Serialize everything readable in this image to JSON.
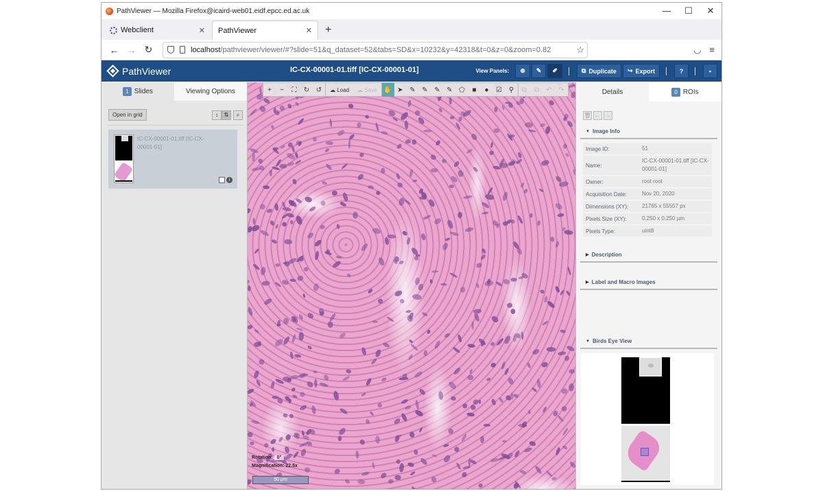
{
  "window": {
    "title": "PathViewer — Mozilla Firefox@icaird-web01.eidf.epcc.ed.ac.uk",
    "controls": [
      "—",
      "☐",
      "✕"
    ]
  },
  "tabs": [
    {
      "label": "Webclient",
      "close": "✕"
    },
    {
      "label": "PathViewer",
      "close": "✕"
    }
  ],
  "newtab": "+",
  "nav": {
    "back": "←",
    "forward": "→",
    "reload": "↻",
    "url_host": "localhost",
    "url_rest": "/pathviewer/viewer/#?slide=51&q_dataset=52&tabs=SD&x=10232&y=42318&t=0&z=0&zoom=0.82",
    "star": "☆",
    "pocket": "◡",
    "menu": "≡"
  },
  "app": {
    "logo_text": "PathViewer",
    "title": "IC-CX-00001-01.tiff [IC-CX-00001-01]",
    "view_panels_label": "View Panels:",
    "duplicate_label": "Duplicate",
    "export_label": "Export",
    "help_label": "?",
    "icons": {
      "globe": "⊕",
      "wrench": "✎",
      "pen": "✐",
      "duplicate": "⧉",
      "export": "↪",
      "window": "▪"
    }
  },
  "left_panel": {
    "slides_count": "1",
    "slides_tab": "Slides",
    "viewing_options_tab": "Viewing Options",
    "open_in_grid": "Open in grid",
    "sort_asc": "↕",
    "sort_desc": "⇅",
    "search_icon": "⌕",
    "thumbnail": {
      "name": "IC-CX-00001-01.tiff [IC-CX-00001-01]",
      "info": "i"
    }
  },
  "viewer": {
    "tools": {
      "zoom_in": "+",
      "zoom_out": "−",
      "fit": "⛶",
      "rotate_cw": "↻",
      "rotate_ccw": "↺",
      "load": "Load",
      "save": "Save",
      "pan": "✋",
      "select": "➤",
      "pen1": "✎",
      "pen2": "✎",
      "pen3": "✎",
      "pen4": "✎",
      "polygon": "⬠",
      "rect": "■",
      "circle": "●",
      "check": "☑",
      "marker": "⚲",
      "copy": "⧉",
      "paste": "⧉",
      "undo": "↶",
      "redo": "↷"
    },
    "rotation_label": "Rotation:",
    "rotation_value": "0°",
    "magnification_label": "Magnification:",
    "magnification_value": "22.5x",
    "scale_label": "50 µm"
  },
  "right_panel": {
    "details_tab": "Details",
    "rois_count": "0",
    "rois_tab": "ROIs",
    "btn_delete": "🗑",
    "btn_prev": "←",
    "btn_next": "→",
    "image_info_header": "Image Info",
    "info": [
      {
        "key": "Image ID:",
        "value": "51"
      },
      {
        "key": "Name:",
        "value": "IC-CX-00001-01.tiff [IC-CX-00001-01]"
      },
      {
        "key": "Owner:",
        "value": "root root"
      },
      {
        "key": "Acquisition Date:",
        "value": "Nov 20, 2020"
      },
      {
        "key": "Dimensions (XY):",
        "value": "21765 x 55557 px"
      },
      {
        "key": "Pixels Size (XY):",
        "value": "0.250 x 0.250 µm"
      },
      {
        "key": "Pixels Type:",
        "value": "uint8"
      }
    ],
    "description_header": "Description",
    "label_macro_header": "Label and Macro Images",
    "birds_eye_header": "Birds Eye View"
  },
  "colors": {
    "header_bg": "#1f4e87",
    "tissue_pink": "#e8a1c8",
    "nucleus_purple": "#7b4a94",
    "tool_active": "#5aa8b0"
  }
}
